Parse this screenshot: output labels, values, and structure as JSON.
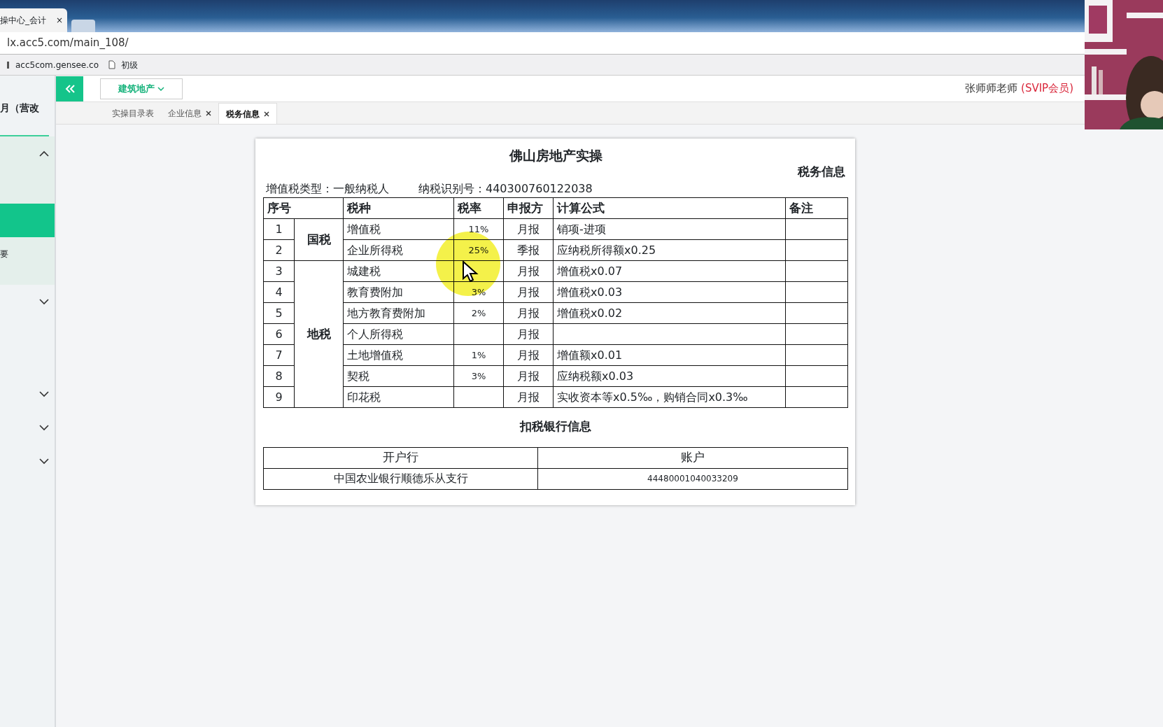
{
  "browser": {
    "tab_title": "操中心_会计",
    "tab_close": "×",
    "address": "lx.acc5.com/main_108/",
    "bookmarks": [
      {
        "label": "acc5com.gensee.co",
        "kind": "site"
      },
      {
        "label": "初级",
        "kind": "page"
      }
    ]
  },
  "header": {
    "industry": "建筑地产",
    "user": "张师师老师",
    "member": "(SVIP会员)"
  },
  "tabs": [
    {
      "label": "实操目录表",
      "closable": false,
      "selected": false
    },
    {
      "label": "企业信息",
      "closable": true,
      "selected": false
    },
    {
      "label": "税务信息",
      "closable": true,
      "selected": true
    }
  ],
  "sidebar": {
    "title": "月（营改",
    "groups": [
      {
        "expanded": true,
        "items": [
          {
            "selected": true
          },
          {
            "label": "要",
            "selected": false
          }
        ]
      },
      {
        "expanded": false
      },
      {
        "expanded": false
      },
      {
        "expanded": false
      },
      {
        "expanded": false
      }
    ]
  },
  "document": {
    "title": "佛山房地产实操",
    "subtitle": "税务信息",
    "vat_type": "增值税类型：一般纳税人",
    "taxpayer_id": "纳税识别号：440300760122038",
    "columns": [
      "序号",
      "税种",
      "税率",
      "申报方",
      "计算公式",
      "备注"
    ],
    "groups": [
      {
        "name": "国税",
        "rows": [
          {
            "no": "1",
            "tax": "增值税",
            "rate": "11%",
            "period": "月报",
            "formula": "销项-进项"
          },
          {
            "no": "2",
            "tax": "企业所得税",
            "rate": "25%",
            "period": "季报",
            "formula": "应纳税所得额x0.25"
          }
        ]
      },
      {
        "name": "地税",
        "rows": [
          {
            "no": "3",
            "tax": "城建税",
            "period": "月报",
            "formula": "增值税x0.07"
          },
          {
            "no": "4",
            "tax": "教育费附加",
            "rate": "3%",
            "period": "月报",
            "formula": "增值税x0.03"
          },
          {
            "no": "5",
            "tax": "地方教育费附加",
            "rate": "2%",
            "period": "月报",
            "formula": "增值税x0.02"
          },
          {
            "no": "6",
            "tax": "个人所得税",
            "period": "月报"
          },
          {
            "no": "7",
            "tax": "土地增值税",
            "rate": "1%",
            "period": "月报",
            "formula": "增值额x0.01"
          },
          {
            "no": "8",
            "tax": "契税",
            "rate": "3%",
            "period": "月报",
            "formula": "应纳税额x0.03"
          },
          {
            "no": "9",
            "tax": "印花税",
            "period": "月报",
            "formula": "实收资本等x0.5‰，购销合同x0.3‰"
          }
        ]
      }
    ],
    "bank_title": "扣税银行信息",
    "bank_columns": [
      "开户行",
      "账户"
    ],
    "bank_rows": [
      [
        "中国农业银行顺德乐从支行",
        "44480001040033209"
      ]
    ]
  }
}
